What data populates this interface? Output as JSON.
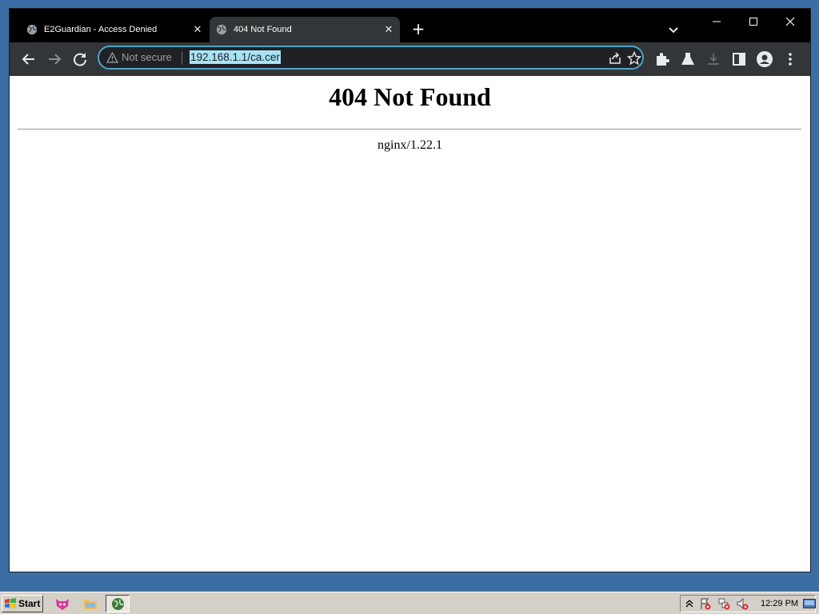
{
  "browser": {
    "tabs": [
      {
        "label": "E2Guardian - Access Denied",
        "close": "✕",
        "active": false
      },
      {
        "label": "404 Not Found",
        "close": "✕",
        "active": true
      }
    ],
    "new_tab": "+",
    "omnibox": {
      "security_label": "Not secure",
      "url": "192.168.1.1/ca.cer"
    }
  },
  "page": {
    "heading": "404 Not Found",
    "server": "nginx/1.22.1"
  },
  "taskbar": {
    "start_label": "Start",
    "clock": "12:29 PM"
  },
  "colors": {
    "titlebar": "#000000",
    "toolbar": "#323639",
    "omnibox_border": "#4fa3c7",
    "url_highlight": "#a8e3f5",
    "desktop": "#3a6ea5",
    "taskbar": "#d4d0c8"
  }
}
